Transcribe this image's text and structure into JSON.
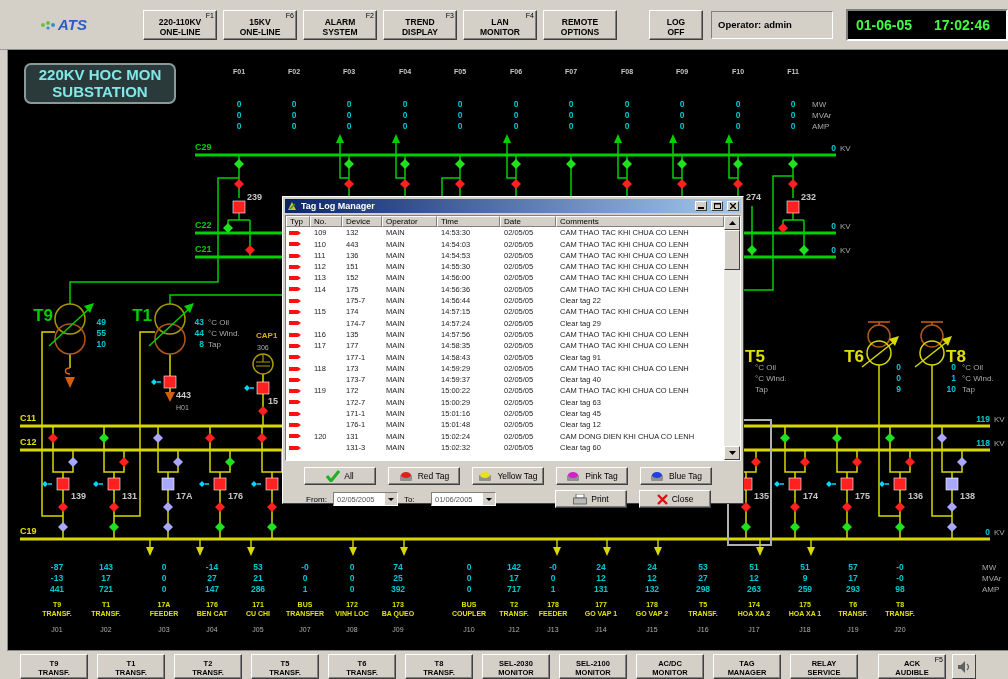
{
  "toolbar": {
    "logo": "ATS",
    "buttons": [
      {
        "lines": [
          "220-110KV",
          "ONE-LINE"
        ],
        "key": "F1"
      },
      {
        "lines": [
          "15KV",
          "ONE-LINE"
        ],
        "key": "F6"
      },
      {
        "lines": [
          "ALARM",
          "SYSTEM"
        ],
        "key": "F2"
      },
      {
        "lines": [
          "TREND",
          "DISPLAY"
        ],
        "key": "F3"
      },
      {
        "lines": [
          "LAN",
          "MONITOR"
        ],
        "key": "F4"
      },
      {
        "lines": [
          "REMOTE",
          "OPTIONS"
        ]
      },
      {
        "lines": [
          "LOG",
          "OFF"
        ]
      }
    ],
    "operator": "Operator: admin",
    "date": "01-06-05",
    "time": "17:02:46"
  },
  "station": {
    "title_lines": [
      "220KV HOC MON",
      "SUBSTATION"
    ]
  },
  "feeders_220": [
    {
      "label": "F01",
      "values": [
        "0",
        "0",
        "0"
      ],
      "arrow": false,
      "switches": [
        {
          "color": "#20e020"
        },
        {
          "color": "#ff2020"
        }
      ]
    },
    {
      "label": "F02",
      "values": [
        "0",
        "0",
        "0"
      ],
      "arrow": false
    },
    {
      "label": "F03",
      "values": [
        "0",
        "0",
        "0"
      ],
      "arrow": true,
      "switches": [
        {
          "color": "#20e020"
        },
        {
          "color": "#ff2020"
        }
      ]
    },
    {
      "label": "F04",
      "values": [
        "0",
        "0",
        "0"
      ],
      "arrow": true,
      "switches": [
        {
          "color": "#20e020"
        },
        {
          "color": "#ff2020"
        }
      ]
    },
    {
      "label": "F05",
      "values": [
        "0",
        "0",
        "0"
      ],
      "arrow": false,
      "switches": [
        {
          "color": "#20e020"
        },
        {
          "color": "#ff2020"
        }
      ]
    },
    {
      "label": "F06",
      "values": [
        "0",
        "0",
        "0"
      ],
      "arrow": true,
      "switches": [
        {
          "color": "#20e020"
        },
        {
          "color": "#ff2020"
        }
      ]
    },
    {
      "label": "F07",
      "values": [
        "0",
        "0",
        "0"
      ],
      "arrow": false,
      "switches": [
        {
          "color": "#20e020"
        }
      ]
    },
    {
      "label": "F08",
      "values": [
        "0",
        "0",
        "0"
      ],
      "arrow": true,
      "switches": [
        {
          "color": "#20e020"
        },
        {
          "color": "#ff2020"
        }
      ]
    },
    {
      "label": "F09",
      "values": [
        "0",
        "0",
        "0"
      ],
      "arrow": true,
      "switches": [
        {
          "color": "#20e020"
        },
        {
          "color": "#ff2020"
        }
      ]
    },
    {
      "label": "F10",
      "values": [
        "0",
        "0",
        "0"
      ],
      "arrow": true,
      "switches": [
        {
          "color": "#20e020"
        },
        {
          "color": "#ff2020"
        }
      ]
    },
    {
      "label": "F11",
      "values": [
        "0",
        "0",
        "0"
      ],
      "arrow": false,
      "switches": [
        {
          "color": "#20e020"
        },
        {
          "color": "#ff2020"
        }
      ]
    }
  ],
  "feeder_units": [
    "MW",
    "MVAr",
    "AMP"
  ],
  "buses_220": [
    {
      "name": "C29",
      "voltage": "0",
      "unit": "KV"
    },
    {
      "name": "C22",
      "voltage": "0",
      "unit": "KV"
    },
    {
      "name": "C21",
      "voltage": "0",
      "unit": "KV"
    }
  ],
  "bays_220": [
    {
      "label": "239",
      "breaker": {
        "color": "#ff2020"
      },
      "c22": {
        "color": "#20e020"
      },
      "c21": {
        "color": "#ff2020"
      }
    },
    {
      "label": "274",
      "c21": {
        "color": "#20e020"
      }
    },
    {
      "label": "232",
      "breaker": {
        "color": "#ff2020"
      },
      "c22": {
        "color": "#ff2020"
      },
      "c21": {
        "color": "#20e020"
      }
    }
  ],
  "transformers": [
    {
      "name": "T9",
      "readings": [
        "49",
        "55",
        "10"
      ]
    },
    {
      "name": "T1",
      "readings": [
        "43",
        "44",
        "8"
      ],
      "units": [
        "°C Oil",
        "°C Wind.",
        "Tap"
      ]
    },
    {
      "name": "T5",
      "units": [
        "°C Oil",
        "°C Wind.",
        "Tap"
      ]
    },
    {
      "name": "T6",
      "readings": [
        "0",
        "0",
        "9"
      ]
    },
    {
      "name": "T8",
      "readings": [
        "0",
        "1",
        "10"
      ],
      "units": [
        "°C Oil",
        "°C Wind.",
        "Tap"
      ]
    }
  ],
  "t1_outlet": {
    "breaker_label": "443",
    "breaker": {
      "color": "#ff2020"
    },
    "tagged": true,
    "name": "H01"
  },
  "capacitor": {
    "name": "CAP1",
    "id": "306",
    "breaker_label": "15",
    "breaker": {
      "color": "#ff2020"
    },
    "tagged": true,
    "switch": {
      "color": "#ff2020"
    }
  },
  "buses_110": [
    {
      "name": "C11",
      "voltage": "119",
      "unit": "KV"
    },
    {
      "name": "C12",
      "voltage": "118",
      "unit": "KV"
    },
    {
      "name": "C19",
      "voltage": "0",
      "unit": "KV"
    }
  ],
  "bays_110": [
    {
      "label": "139",
      "tagged": true,
      "selected": false,
      "upper": {
        "color": "#ff2020"
      },
      "lower_bus": {
        "color": "#a8a8ff"
      },
      "breaker": {
        "color": "#ff2020"
      },
      "below": {
        "color": "#ff2020"
      },
      "bus19": {
        "color": "#a8a8ff"
      }
    },
    {
      "label": "131",
      "tagged": true,
      "selected": false,
      "upper": {
        "color": "#20e020"
      },
      "lower_bus": {
        "color": "#ff2020"
      },
      "breaker": {
        "color": "#ff2020"
      },
      "below": {
        "color": "#ff2020"
      },
      "bus19": {
        "color": "#20e020"
      }
    },
    {
      "label": "17A",
      "tagged": false,
      "selected": false,
      "upper": {
        "color": "#a8a8ff"
      },
      "lower_bus": {
        "color": "#a8a8ff"
      },
      "breaker": {
        "color": "#a8a8ff"
      },
      "below": {
        "color": "#a8a8ff"
      },
      "bus19": {
        "color": "#a8a8ff"
      }
    },
    {
      "label": "176",
      "tagged": true,
      "selected": false,
      "upper": {
        "color": "#ff2020"
      },
      "lower_bus": {
        "color": "#20e020"
      },
      "breaker": {
        "color": "#ff2020"
      },
      "below": {
        "color": "#ff2020"
      },
      "bus19": {
        "color": "#20e020"
      }
    },
    {
      "tagged": true,
      "selected": false,
      "upper": {
        "color": "#ff2020"
      },
      "breaker": {
        "color": "#ff2020"
      },
      "below": {
        "color": "#ff2020"
      },
      "bus19": {
        "color": "#20e020"
      }
    },
    {
      "label": "135",
      "tagged": false,
      "selected": true,
      "lower_bus": {
        "color": "#ff2020"
      },
      "breaker": {
        "color": "#ff2020"
      },
      "below": {
        "color": "#ff2020"
      },
      "bus19": {
        "color": "#20e020"
      }
    },
    {
      "label": "174",
      "tagged": true,
      "selected": false,
      "upper": {
        "color": "#20e020"
      },
      "lower_bus": {
        "color": "#ff2020"
      },
      "breaker": {
        "color": "#ff2020"
      },
      "below": {
        "color": "#ff2020"
      },
      "bus19": {
        "color": "#20e020"
      }
    },
    {
      "label": "175",
      "tagged": true,
      "selected": false,
      "upper": {
        "color": "#20e020"
      },
      "lower_bus": {
        "color": "#ff2020"
      },
      "breaker": {
        "color": "#ff2020"
      },
      "below": {
        "color": "#ff2020"
      },
      "bus19": {
        "color": "#20e020"
      }
    },
    {
      "label": "136",
      "tagged": true,
      "selected": false,
      "upper": {
        "color": "#20e020"
      },
      "lower_bus": {
        "color": "#ff2020"
      },
      "breaker": {
        "color": "#ff2020"
      },
      "below": {
        "color": "#ff2020"
      },
      "bus19": {
        "color": "#20e020"
      }
    },
    {
      "label": "138",
      "tagged": false,
      "selected": false,
      "upper": {
        "color": "#a8a8ff"
      },
      "lower_bus": {
        "color": "#a8a8ff"
      },
      "breaker": {
        "color": "#a8a8ff"
      },
      "below": {
        "color": "#a8a8ff"
      },
      "bus19": {
        "color": "#a8a8ff"
      }
    }
  ],
  "outputs": [
    {
      "mw": "-87",
      "mvar": "-13",
      "amp": "441",
      "name": [
        "T9",
        "TRANSF."
      ],
      "id": "J01"
    },
    {
      "mw": "143",
      "mvar": "17",
      "amp": "721",
      "name": [
        "T1",
        "TRANSF."
      ],
      "id": "J02"
    },
    {
      "mw": "0",
      "mvar": "0",
      "amp": "0",
      "name": [
        "17A",
        "FEEDER"
      ],
      "id": "J03"
    },
    {
      "mw": "-14",
      "mvar": "27",
      "amp": "147",
      "name": [
        "176",
        "BEN CAT"
      ],
      "id": "J04"
    },
    {
      "mw": "53",
      "mvar": "21",
      "amp": "286",
      "name": [
        "171",
        "CU CHI"
      ],
      "id": "J05"
    },
    {
      "mw": "-0",
      "mvar": "0",
      "amp": "1",
      "name": [
        "BUS",
        "TRANSFER"
      ],
      "id": "J07"
    },
    {
      "mw": "0",
      "mvar": "0",
      "amp": "0",
      "name": [
        "172",
        "VINH LOC"
      ],
      "id": "J08"
    },
    {
      "mw": "74",
      "mvar": "25",
      "amp": "392",
      "name": [
        "173",
        "BA QUEO"
      ],
      "id": "J09"
    },
    {
      "mw": "0",
      "mvar": "0",
      "amp": "0",
      "name": [
        "BUS",
        "COUPLER"
      ],
      "id": "J10"
    },
    {
      "mw": "142",
      "mvar": "17",
      "amp": "717",
      "name": [
        "T2",
        "TRANSF."
      ],
      "id": "J12"
    },
    {
      "mw": "-0",
      "mvar": "0",
      "amp": "1",
      "name": [
        "178",
        "FEEDER"
      ],
      "id": "J13"
    },
    {
      "mw": "24",
      "mvar": "12",
      "amp": "131",
      "name": [
        "177",
        "GO VAP 1"
      ],
      "id": "J14"
    },
    {
      "mw": "24",
      "mvar": "12",
      "amp": "132",
      "name": [
        "178",
        "GO VAP 2"
      ],
      "id": "J15"
    },
    {
      "mw": "53",
      "mvar": "27",
      "amp": "298",
      "name": [
        "T5",
        "TRANSF."
      ],
      "id": "J16"
    },
    {
      "mw": "51",
      "mvar": "12",
      "amp": "263",
      "name": [
        "174",
        "HOA XA 2"
      ],
      "id": "J17"
    },
    {
      "mw": "51",
      "mvar": "9",
      "amp": "259",
      "name": [
        "175",
        "HOA XA 1"
      ],
      "id": "J18"
    },
    {
      "mw": "57",
      "mvar": "17",
      "amp": "293",
      "name": [
        "T6",
        "TRANSF."
      ],
      "id": "J19"
    },
    {
      "mw": "-0",
      "mvar": "-0",
      "amp": "98",
      "name": [
        "T8",
        "TRANSF."
      ],
      "id": "J20"
    }
  ],
  "output_units": [
    "MW",
    "MVAr",
    "AMP"
  ],
  "dialog": {
    "title": "Tag Log Manager",
    "columns": [
      "Typ",
      "No.",
      "Device",
      "Operator",
      "Time",
      "Date",
      "Comments"
    ],
    "rows": [
      {
        "no": "109",
        "device": "132",
        "operator": "MAIN",
        "time": "14:53:30",
        "date": "02/05/05",
        "comment": "CAM THAO TAC KHI CHUA CO LENH"
      },
      {
        "no": "110",
        "device": "443",
        "operator": "MAIN",
        "time": "14:54:03",
        "date": "02/05/05",
        "comment": "CAM THAO TAC KHI CHUA CO LENH"
      },
      {
        "no": "111",
        "device": "136",
        "operator": "MAIN",
        "time": "14:54:53",
        "date": "02/05/05",
        "comment": "CAM THAO TAC KHI CHUA CO LENH"
      },
      {
        "no": "112",
        "device": "151",
        "operator": "MAIN",
        "time": "14:55:30",
        "date": "02/05/05",
        "comment": "CAM THAO TAC KHI CHUA CO LENH"
      },
      {
        "no": "113",
        "device": "152",
        "operator": "MAIN",
        "time": "14:56:00",
        "date": "02/05/05",
        "comment": "CAM THAO TAC KHI CHUA CO LENH"
      },
      {
        "no": "114",
        "device": "175",
        "operator": "MAIN",
        "time": "14:56:36",
        "date": "02/05/05",
        "comment": "CAM THAO TAC KHI CHUA CO LENH"
      },
      {
        "device": "175-7",
        "operator": "MAIN",
        "time": "14:56:44",
        "date": "02/05/05",
        "comment": "Clear tag 22"
      },
      {
        "no": "115",
        "device": "174",
        "operator": "MAIN",
        "time": "14:57:15",
        "date": "02/05/05",
        "comment": "CAM THAO TAC KHI CHUA CO LENH"
      },
      {
        "device": "174-7",
        "operator": "MAIN",
        "time": "14:57:24",
        "date": "02/05/05",
        "comment": "Clear tag 29"
      },
      {
        "no": "116",
        "device": "135",
        "operator": "MAIN",
        "time": "14:57:56",
        "date": "02/05/05",
        "comment": "CAM THAO TAC KHI CHUA CO LENH"
      },
      {
        "no": "117",
        "device": "177",
        "operator": "MAIN",
        "time": "14:58:35",
        "date": "02/05/05",
        "comment": "CAM THAO TAC KHI CHUA CO LENH"
      },
      {
        "device": "177-1",
        "operator": "MAIN",
        "time": "14:58:43",
        "date": "02/05/05",
        "comment": "Clear tag 91"
      },
      {
        "no": "118",
        "device": "173",
        "operator": "MAIN",
        "time": "14:59:29",
        "date": "02/05/05",
        "comment": "CAM THAO TAC KHI CHUA CO LENH"
      },
      {
        "device": "173-7",
        "operator": "MAIN",
        "time": "14:59:37",
        "date": "02/05/05",
        "comment": "Clear tag 40"
      },
      {
        "no": "119",
        "device": "172",
        "operator": "MAIN",
        "time": "15:00:22",
        "date": "02/05/05",
        "comment": "CAM THAO TAC KHI CHUA CO LENH"
      },
      {
        "device": "172-7",
        "operator": "MAIN",
        "time": "15:00:29",
        "date": "02/05/05",
        "comment": "Clear tag 63"
      },
      {
        "device": "171-1",
        "operator": "MAIN",
        "time": "15:01:16",
        "date": "02/05/05",
        "comment": "Clear tag 45"
      },
      {
        "device": "176-1",
        "operator": "MAIN",
        "time": "15:01:48",
        "date": "02/05/05",
        "comment": "Clear tag 12"
      },
      {
        "no": "120",
        "device": "131",
        "operator": "MAIN",
        "time": "15:02:24",
        "date": "02/05/05",
        "comment": "CAM DONG DIEN KHI CHUA CO LENH"
      },
      {
        "device": "131-3",
        "operator": "MAIN",
        "time": "15:02:32",
        "date": "02/05/05",
        "comment": "Clear tag 60"
      }
    ],
    "filters": [
      {
        "label": "All",
        "kind": "check"
      },
      {
        "label": "Red Tag",
        "kind": "tag",
        "color": "#e02020"
      },
      {
        "label": "Yellow Tag",
        "kind": "tag",
        "color": "#e8e020"
      },
      {
        "label": "Pink Tag",
        "kind": "tag",
        "color": "#d020d0"
      },
      {
        "label": "Blue Tag",
        "kind": "tag",
        "color": "#2040e0"
      }
    ],
    "from_label": "From:",
    "from": "02/05/2005",
    "to_label": "To:",
    "to": "01/06/2005",
    "print": "Print",
    "close": "Close"
  },
  "footer": {
    "buttons": [
      {
        "lines": [
          "T9",
          "TRANSF."
        ]
      },
      {
        "lines": [
          "T1",
          "TRANSF."
        ]
      },
      {
        "lines": [
          "T2",
          "TRANSF."
        ]
      },
      {
        "lines": [
          "T5",
          "TRANSF."
        ]
      },
      {
        "lines": [
          "T6",
          "TRANSF."
        ]
      },
      {
        "lines": [
          "T8",
          "TRANSF."
        ]
      },
      {
        "lines": [
          "SEL-2030",
          "MONITOR"
        ]
      },
      {
        "lines": [
          "SEL-2100",
          "MONITOR"
        ]
      },
      {
        "lines": [
          "AC/DC",
          "MONITOR"
        ]
      },
      {
        "lines": [
          "TAG",
          "MANAGER"
        ]
      },
      {
        "lines": [
          "RELAY",
          "SERVICE"
        ]
      },
      {
        "lines": [
          "ACK",
          "AUDIBLE"
        ],
        "key": "F5"
      }
    ]
  }
}
